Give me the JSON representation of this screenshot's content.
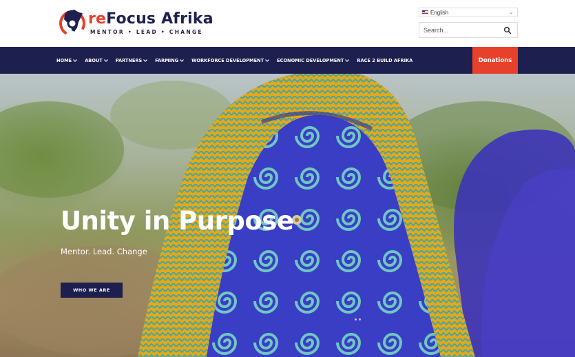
{
  "brand": {
    "name_prefix": "re",
    "name_rest": "Focus Afrika",
    "tagline": "MENTOR • LEAD • CHANGE",
    "colors": {
      "navy": "#1d1f4e",
      "accent": "#e8412b"
    }
  },
  "language": {
    "selected": "English",
    "flag_icon": "us-flag-icon"
  },
  "search": {
    "placeholder": "Search..."
  },
  "nav": {
    "items": [
      {
        "label": "HOME"
      },
      {
        "label": "ABOUT"
      },
      {
        "label": "PARTNERS"
      },
      {
        "label": "FARMING"
      },
      {
        "label": "WORKFORCE DEVELOPMENT"
      },
      {
        "label": "ECONOMIC DEVELOPMENT"
      },
      {
        "label": "RACE 2 BUILD AFRIKA"
      }
    ],
    "donate_label": "Donations"
  },
  "hero": {
    "title": "Unity in Purpose",
    "subtitle": "Mentor. Lead. Change",
    "button_label": "WHO WE ARE"
  }
}
